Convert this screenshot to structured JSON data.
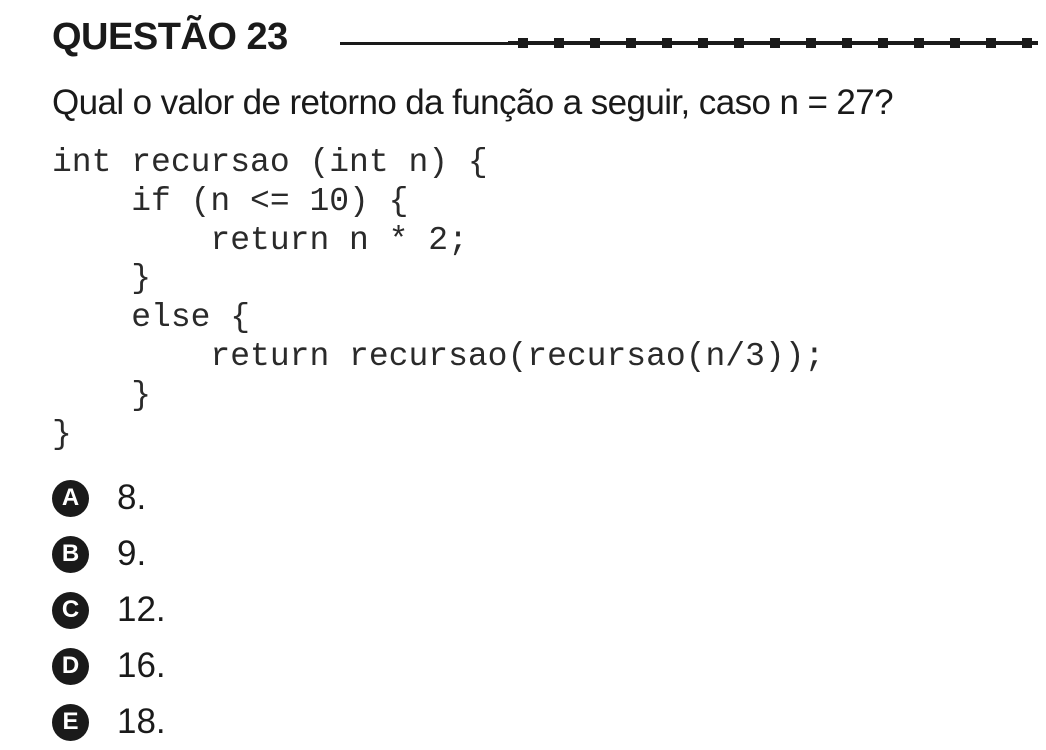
{
  "question": {
    "title": "QUESTÃO 23",
    "text": "Qual o valor de retorno da função a seguir, caso n = 27?"
  },
  "code": {
    "lines": [
      "int recursao (int n) {",
      "    if (n <= 10) {",
      "        return n * 2;",
      "    }",
      "    else {",
      "        return recursao(recursao(n/3));",
      "    }",
      "}"
    ]
  },
  "options": [
    {
      "letter": "A",
      "text": "8."
    },
    {
      "letter": "B",
      "text": "9."
    },
    {
      "letter": "C",
      "text": "12."
    },
    {
      "letter": "D",
      "text": "16."
    },
    {
      "letter": "E",
      "text": "18."
    }
  ]
}
